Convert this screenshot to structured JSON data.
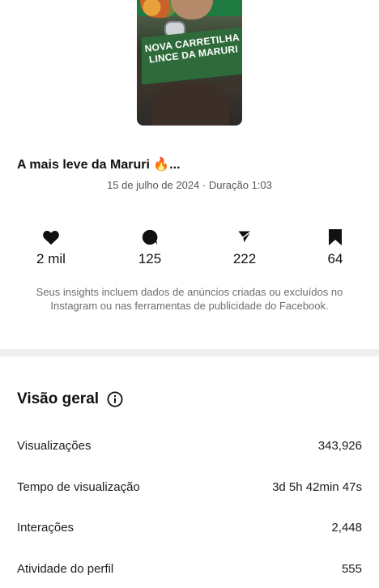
{
  "post": {
    "thumbnail_text": "NOVA CARRETILHA LINCE DA MARURI",
    "caption": "A mais leve da Maruri 🔥...",
    "meta": "15 de julho de 2024 · Duração 1:03"
  },
  "stats": {
    "likes": "2 mil",
    "comments": "125",
    "shares": "222",
    "saves": "64"
  },
  "notice": "Seus insights incluem dados de anúncios criadas ou excluídos no Instagram ou nas ferramentas de publicidade do Facebook.",
  "overview": {
    "title": "Visão geral",
    "rows": [
      {
        "label": "Visualizações",
        "value": "343,926"
      },
      {
        "label": "Tempo de visualização",
        "value": "3d 5h 42min 47s"
      },
      {
        "label": "Interações",
        "value": "2,448"
      },
      {
        "label": "Atividade do perfil",
        "value": "555"
      }
    ]
  },
  "icons": {
    "likes": "heart-icon",
    "comments": "comment-icon",
    "shares": "share-icon",
    "saves": "bookmark-icon",
    "info": "info-icon"
  }
}
